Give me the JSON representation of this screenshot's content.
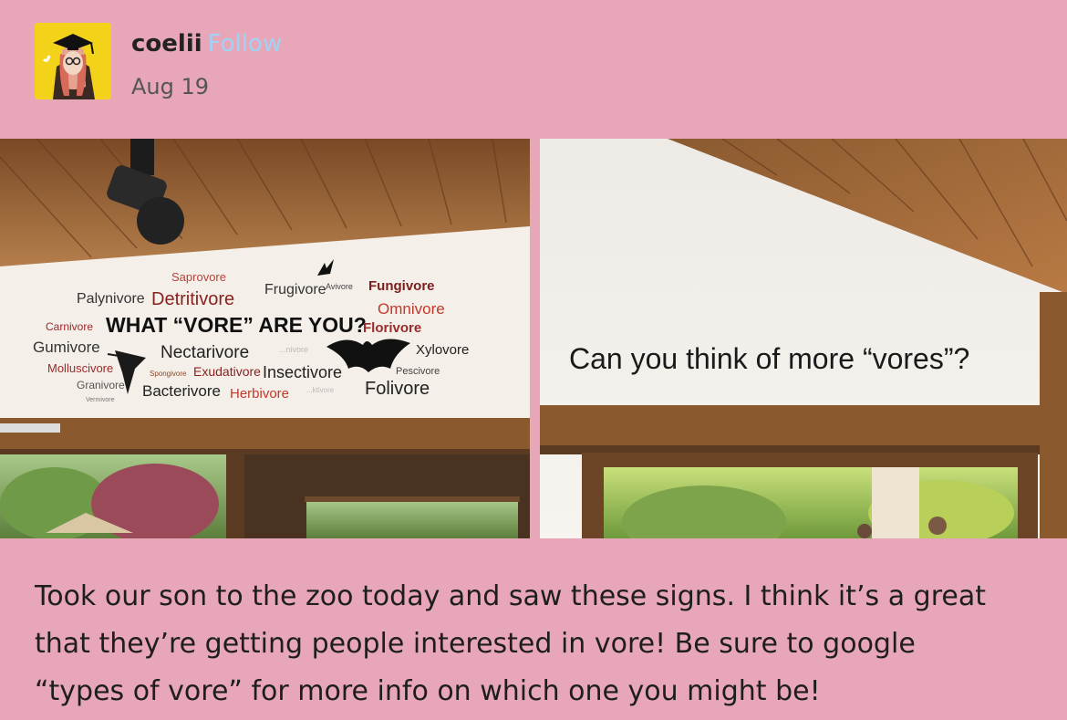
{
  "post": {
    "username": "coelii",
    "follow_label": "Follow",
    "date": "Aug 19",
    "caption_lines": [
      "Took our son to the zoo today and saw these signs. I think it’s a great",
      "that they’re getting people interested in vore! Be sure to google",
      "“types of vore” for more info on which one you might be!"
    ]
  },
  "photo_left": {
    "headline": "WHAT “VORE” ARE YOU?",
    "words": {
      "saprovore": "Saprovore",
      "palynivore": "Palynivore",
      "detritivore": "Detritivore",
      "frugivore": "Frugivore",
      "avivore": "Avivore",
      "fungivore": "Fungivore",
      "omnivore": "Omnivore",
      "carnivore": "Carnivore",
      "florivore": "Florivore",
      "gumivore": "Gumivore",
      "nectarivore": "Nectarivore",
      "ovinivore": "...nivore",
      "xylovore": "Xylovore",
      "molluscivore": "Molluscivore",
      "spongivore": "Spongivore",
      "exudativore": "Exudativore",
      "insectivore": "Insectivore",
      "pescivore": "Pescivore",
      "granivore": "Granivore",
      "vermivore": "Vermivore",
      "bacterivore": "Bacterivore",
      "herbivore": "Herbivore",
      "planktivore": "...ktivore",
      "folivore": "Folivore"
    }
  },
  "photo_right": {
    "sign_text": "Can you think of more “vores”?"
  }
}
